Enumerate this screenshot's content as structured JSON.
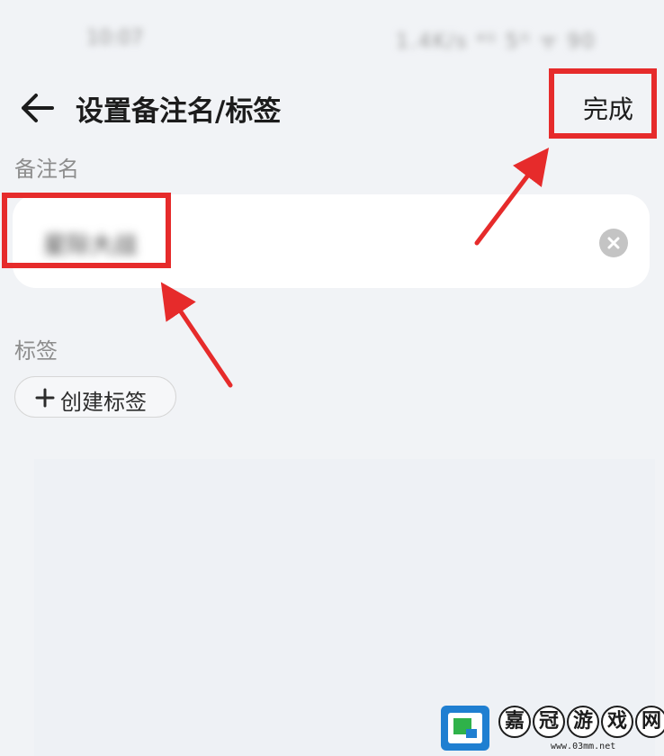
{
  "status_bar": {
    "time": "10:07",
    "icons_text": "1.4K/s ⁴ᴳ 5ᴳ ᯤ 90"
  },
  "header": {
    "back_icon": "back-arrow-icon",
    "title": "设置备注名/标签",
    "done_label": "完成"
  },
  "remark": {
    "section_label": "备注名",
    "value": "星际大战",
    "clear_icon": "clear-circle-icon"
  },
  "tags": {
    "section_label": "标签",
    "create_label": "创建标签",
    "create_icon": "plus-icon"
  },
  "watermark": {
    "chars": [
      "嘉",
      "冠",
      "游",
      "戏",
      "网"
    ],
    "url": "www.03mm.net"
  },
  "colors": {
    "highlight": "#e62b2b",
    "background": "#f1f3f6"
  }
}
